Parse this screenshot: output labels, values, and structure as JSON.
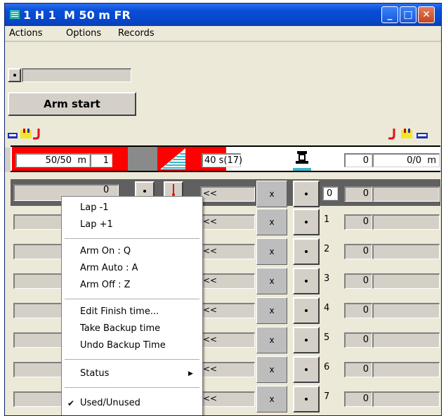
{
  "window": {
    "title": "1 H 1  M 50 m FR"
  },
  "menu": [
    "Actions",
    "Options",
    "Records"
  ],
  "controls": {
    "arm_start_label": "Arm start",
    "status_field": ""
  },
  "header_row": {
    "distance": "50/50  m",
    "lap_count": "1",
    "time_limit": "40 s(17)",
    "count": "0",
    "total_distance": "0/0  m"
  },
  "lanes": [
    {
      "lane": "0",
      "marker": "<<",
      "x_label": "x",
      "value": "0",
      "laps": "0"
    },
    {
      "lane": "1",
      "marker": "<<",
      "x_label": "x",
      "value": "0"
    },
    {
      "lane": "2",
      "marker": "<<",
      "x_label": "x",
      "value": "0"
    },
    {
      "lane": "3",
      "marker": "<<",
      "x_label": "x",
      "value": "0"
    },
    {
      "lane": "4",
      "marker": "<<",
      "x_label": "x",
      "value": "0"
    },
    {
      "lane": "5",
      "marker": "<<",
      "x_label": "x",
      "value": "0"
    },
    {
      "lane": "6",
      "marker": "<<",
      "x_label": "x",
      "value": "0"
    },
    {
      "lane": "7",
      "marker": "<<",
      "x_label": "x",
      "value": "0"
    }
  ],
  "context_menu": {
    "items": [
      "Lap -1",
      "Lap +1",
      "Arm On  : Q",
      "Arm Auto  : A",
      "Arm Off  : Z",
      "Edit Finish time...",
      "Take Backup time",
      "Undo Backup Time",
      "Status",
      "Used/Unused"
    ],
    "submenu_arrow": "▶",
    "check": "✔"
  },
  "colors": {
    "titlebar": "#0a4fd8",
    "header_red": "#ff0000",
    "accent_cyan": "#3fb6c8"
  }
}
